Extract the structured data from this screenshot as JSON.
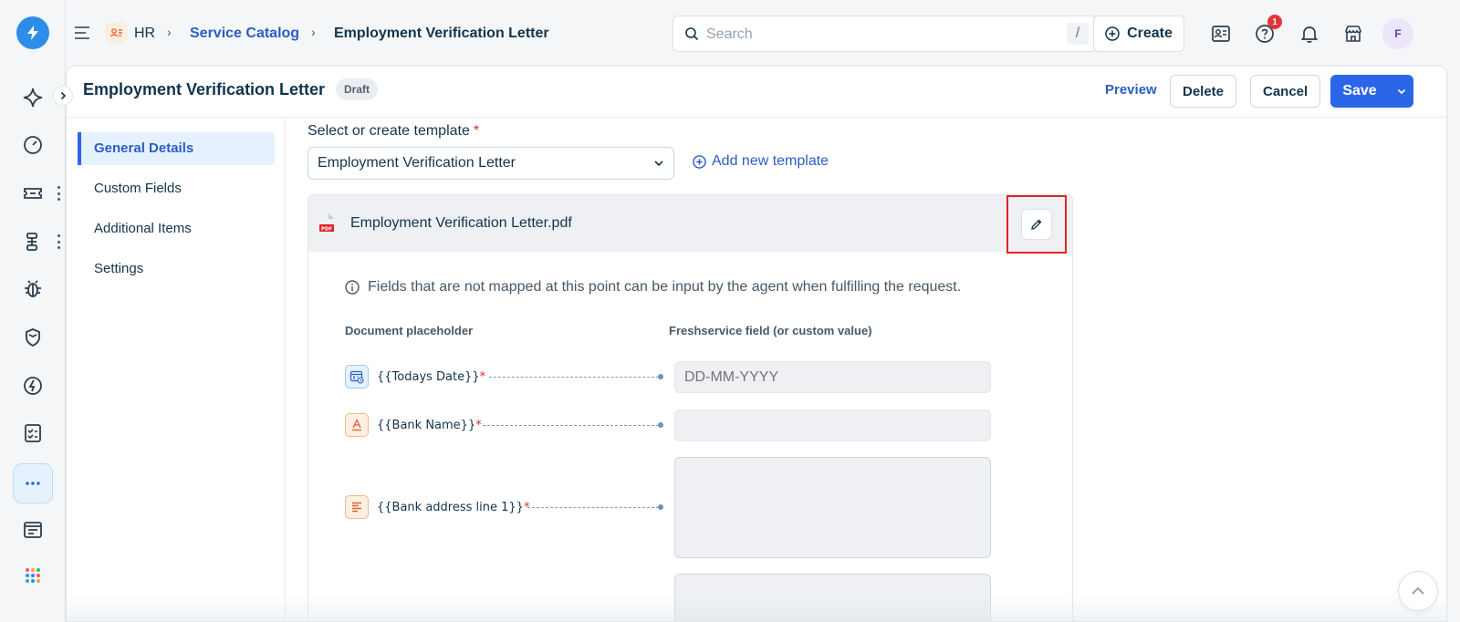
{
  "topbar": {
    "breadcrumb": {
      "root": "HR",
      "parent": "Service Catalog",
      "current": "Employment Verification Letter"
    },
    "search_placeholder": "Search",
    "search_shortcut": "/",
    "create_label": "Create",
    "help_badge_count": "1",
    "avatar_initial": "F"
  },
  "header": {
    "title": "Employment Verification Letter",
    "status": "Draft",
    "preview_label": "Preview",
    "delete_label": "Delete",
    "cancel_label": "Cancel",
    "save_label": "Save"
  },
  "sidenav": {
    "items": [
      {
        "label": "General Details",
        "active": true
      },
      {
        "label": "Custom Fields",
        "active": false
      },
      {
        "label": "Additional Items",
        "active": false
      },
      {
        "label": "Settings",
        "active": false
      }
    ]
  },
  "template": {
    "label": "Select or create template",
    "required_mark": "*",
    "selected": "Employment Verification Letter",
    "add_new_label": "Add new template"
  },
  "document": {
    "file_name": "Employment Verification Letter.pdf",
    "info_text": "Fields that are not mapped at this point can be input by the agent when fulfilling the request.",
    "col_placeholder": "Document placeholder",
    "col_field": "Freshservice field (or custom value)",
    "mappings": [
      {
        "placeholder": "{{Todays Date}}",
        "required": "*",
        "icon": "calendar-icon",
        "value_placeholder": "DD-MM-YYYY"
      },
      {
        "placeholder": "{{Bank Name}}",
        "required": "*",
        "icon": "text-field-icon",
        "value_placeholder": ""
      },
      {
        "placeholder": "{{Bank address line 1}}",
        "required": "*",
        "icon": "paragraph-icon",
        "value_placeholder": ""
      }
    ]
  },
  "colors": {
    "accent": "#2c66e8",
    "link": "#2c5cc5",
    "highlight": "#e02424"
  }
}
